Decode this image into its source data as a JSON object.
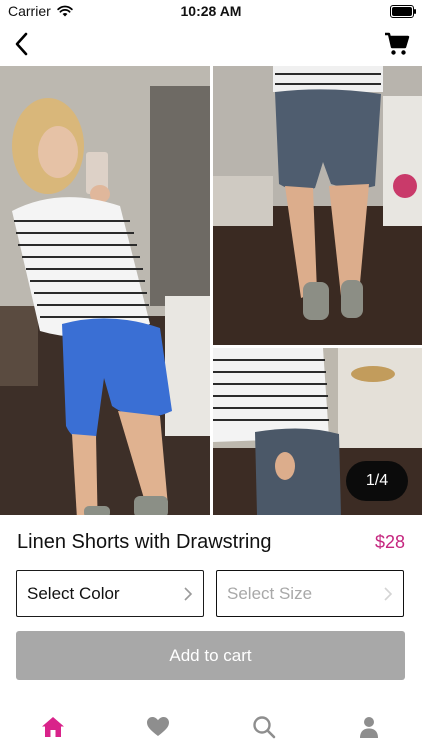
{
  "status_bar": {
    "carrier": "Carrier",
    "time": "10:28 AM",
    "battery_level": 1.0
  },
  "nav": {
    "back_icon": "chevron-left-icon",
    "cart_icon": "shopping-cart-icon"
  },
  "gallery": {
    "page_indicator": "1/4"
  },
  "product": {
    "title": "Linen Shorts with Drawstring",
    "price": "$28"
  },
  "selectors": {
    "color_label": "Select Color",
    "size_label": "Select Size"
  },
  "actions": {
    "add_to_cart": "Add to cart"
  },
  "tabs": [
    {
      "icon": "home-icon",
      "active": true
    },
    {
      "icon": "heart-icon",
      "active": false
    },
    {
      "icon": "search-icon",
      "active": false
    },
    {
      "icon": "profile-icon",
      "active": false
    }
  ],
  "colors": {
    "accent": "#d9238a",
    "price": "#c5267f",
    "button_disabled": "#a8a8a8",
    "inactive_icon": "#8e8e8e"
  }
}
